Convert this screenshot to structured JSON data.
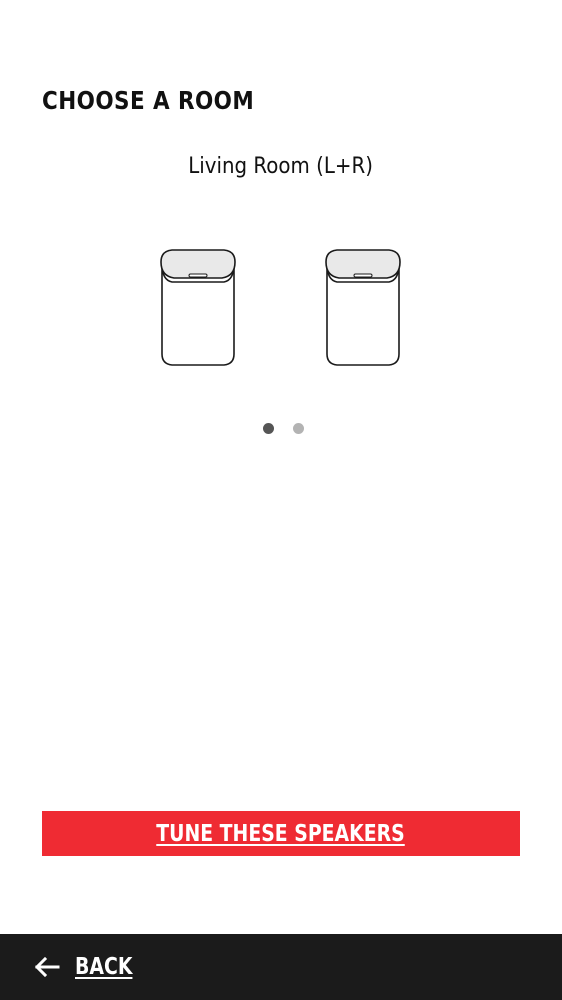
{
  "header": {
    "title": "CHOOSE A ROOM"
  },
  "room": {
    "name": "Living Room (L+R)",
    "speaker_count": 2,
    "speaker_icons": [
      "speaker-left-icon",
      "speaker-right-icon"
    ]
  },
  "pager": {
    "page_count": 2,
    "active_index": 0,
    "active_color": "#555555",
    "inactive_color": "#b3b3b3"
  },
  "actions": {
    "tune_label": "TUNE THESE SPEAKERS",
    "tune_color": "#ef2b33"
  },
  "nav": {
    "back_label": "BACK",
    "back_icon": "arrow-left-icon",
    "bar_color": "#1b1b1b"
  }
}
